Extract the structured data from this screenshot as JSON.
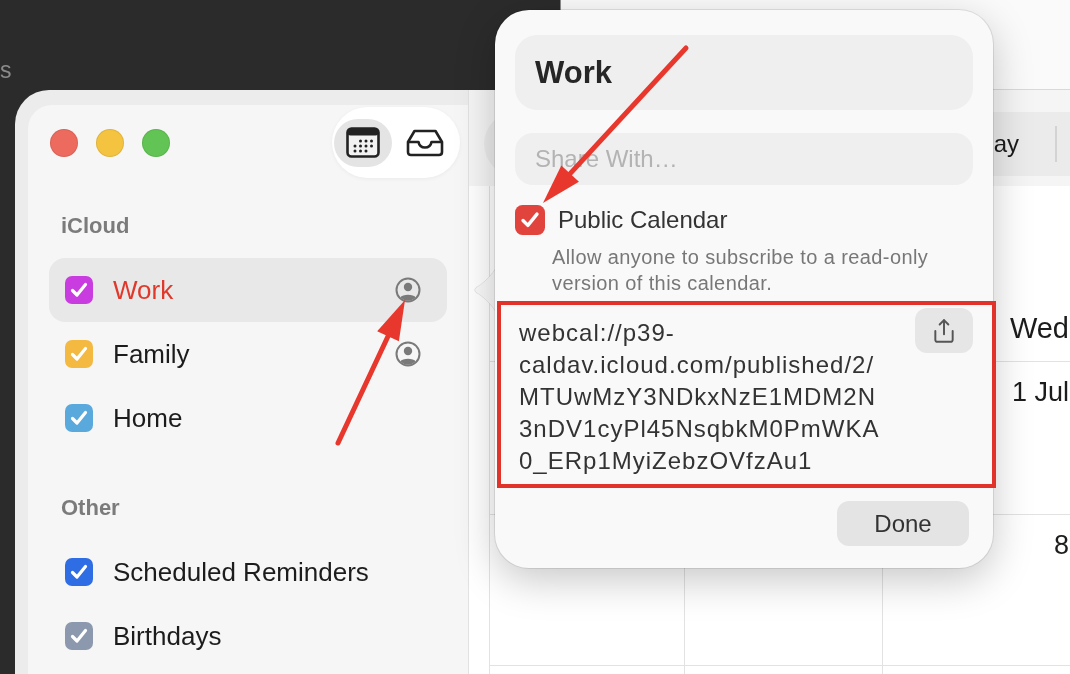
{
  "desktop": {
    "edge_text": "s"
  },
  "sidebar": {
    "toolbar": [
      {
        "kind": "calendar",
        "selected": true
      },
      {
        "kind": "inbox",
        "selected": false
      }
    ],
    "sections": [
      {
        "title": "iCloud",
        "calendars": [
          {
            "name": "Work",
            "checked": true,
            "color": "#c93ce0",
            "selected": true,
            "shared": true
          },
          {
            "name": "Family",
            "checked": true,
            "color": "#f3b940",
            "selected": false,
            "shared": true
          },
          {
            "name": "Home",
            "checked": true,
            "color": "#5aa9dd",
            "selected": false,
            "shared": false
          }
        ]
      },
      {
        "title": "Other",
        "calendars": [
          {
            "name": "Scheduled Reminders",
            "checked": true,
            "color": "#2f6de4",
            "selected": false,
            "shared": false
          },
          {
            "name": "Birthdays",
            "checked": true,
            "color": "#8c98ae",
            "selected": false,
            "shared": false
          }
        ]
      }
    ]
  },
  "toolbar": {
    "view_segment": "ay"
  },
  "calendar": {
    "column_header": "Wed",
    "dates": [
      "1 Jul",
      "8"
    ]
  },
  "popover": {
    "title": "Work",
    "share_field": {
      "placeholder": "Share With…"
    },
    "public_calendar": {
      "label": "Public Calendar",
      "checked": true,
      "description": "Allow anyone to subscribe to a read-only version of this calendar."
    },
    "url_lines": [
      "webcal://p39-",
      "caldav.icloud.com/published/2/",
      "MTUwMzY3NDkxNzE1MDM2N",
      "3nDV1cyPl45NsqbkM0PmWKA",
      "0_ERp1MyiZebzOVfzAu1"
    ],
    "done_button": "Done"
  }
}
